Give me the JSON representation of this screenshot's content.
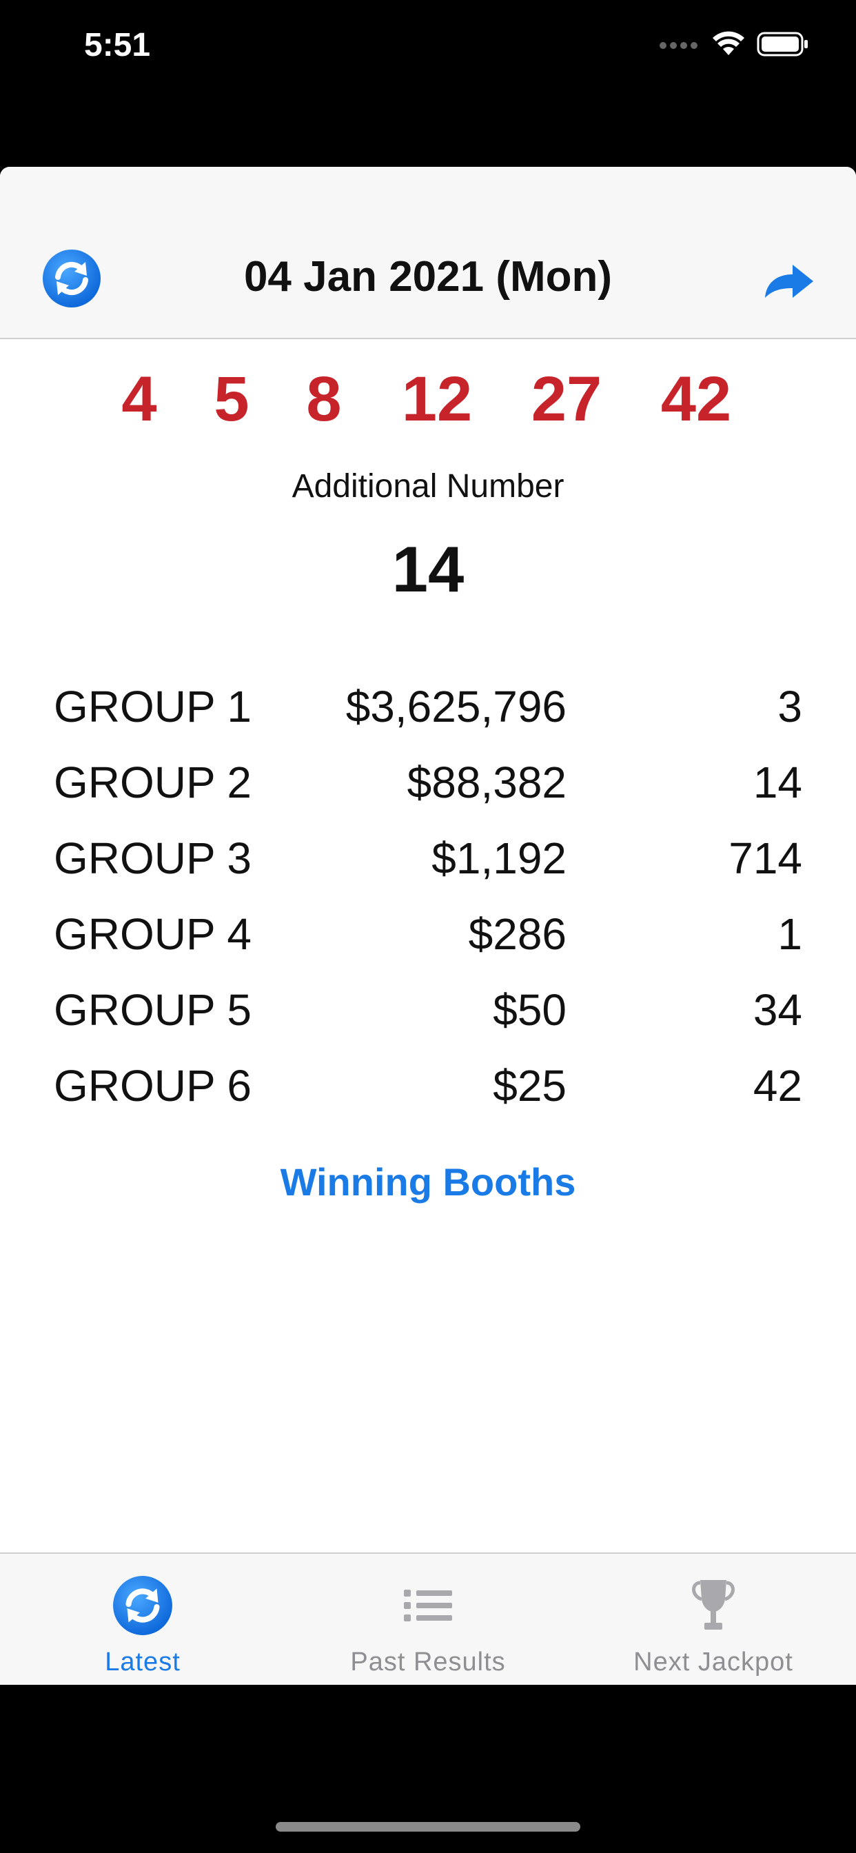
{
  "status_bar": {
    "time": "5:51"
  },
  "nav": {
    "title": "04 Jan 2021 (Mon)",
    "left_icon": "refresh-icon",
    "right_icon": "share-arrow-icon"
  },
  "draw": {
    "winning_numbers": [
      "4",
      "5",
      "8",
      "12",
      "27",
      "42"
    ],
    "additional_label": "Additional Number",
    "additional_number": "14"
  },
  "prizes": [
    {
      "group": "GROUP 1",
      "amount": "$3,625,796",
      "winners": "3"
    },
    {
      "group": "GROUP 2",
      "amount": "$88,382",
      "winners": "14"
    },
    {
      "group": "GROUP 3",
      "amount": "$1,192",
      "winners": "714"
    },
    {
      "group": "GROUP 4",
      "amount": "$286",
      "winners": "1"
    },
    {
      "group": "GROUP 5",
      "amount": "$50",
      "winners": "34"
    },
    {
      "group": "GROUP 6",
      "amount": "$25",
      "winners": "42"
    }
  ],
  "links": {
    "winning_booths": "Winning Booths"
  },
  "tabs": [
    {
      "label": "Latest",
      "icon": "refresh-icon",
      "active": true
    },
    {
      "label": "Past Results",
      "icon": "list-icon",
      "active": false
    },
    {
      "label": "Next Jackpot",
      "icon": "trophy-icon",
      "active": false
    }
  ],
  "colors": {
    "accent": "#1a7be6",
    "numbers": "#c6242a",
    "inactive_tab": "#8e8e93"
  }
}
